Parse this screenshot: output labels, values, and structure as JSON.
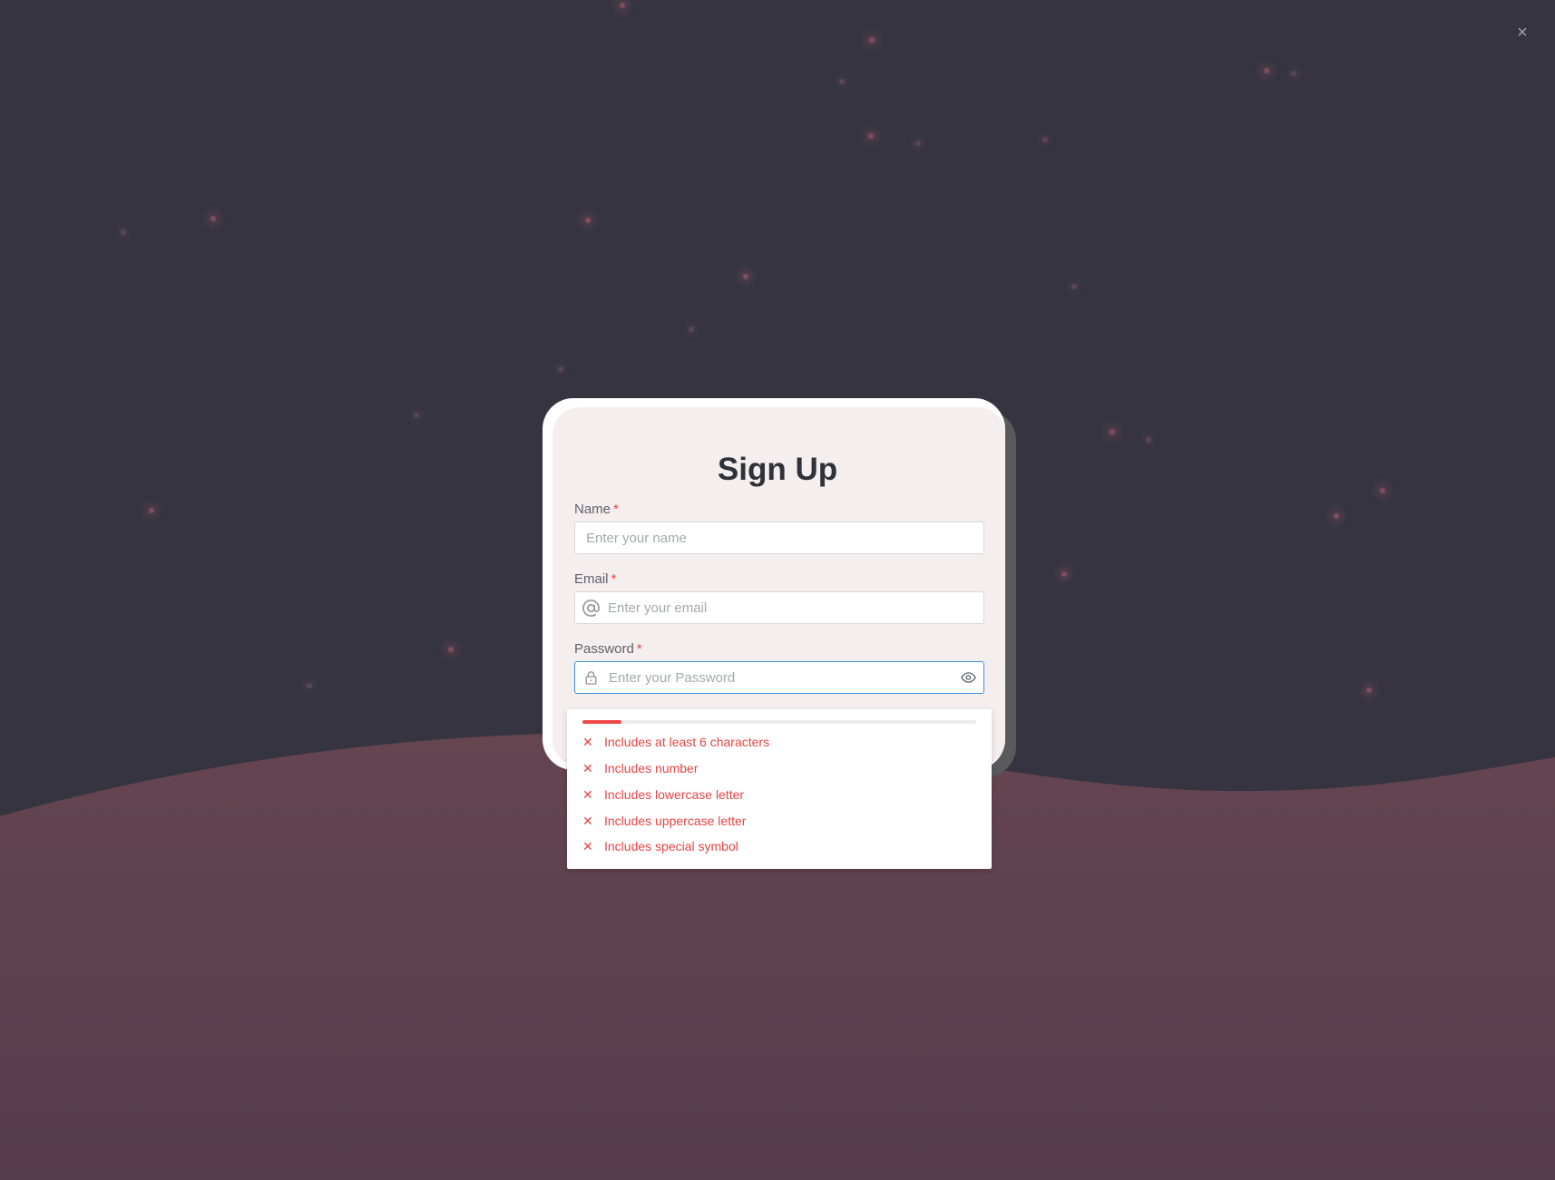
{
  "page": {
    "close_label": "×"
  },
  "form": {
    "title": "Sign Up",
    "name": {
      "label": "Name",
      "required_mark": "*",
      "placeholder": "Enter your name",
      "value": ""
    },
    "email": {
      "label": "Email",
      "required_mark": "*",
      "placeholder": "Enter your email",
      "value": ""
    },
    "password": {
      "label": "Password",
      "required_mark": "*",
      "placeholder": "Enter your Password",
      "value": ""
    }
  },
  "password_strength": {
    "level_fraction": 0.1,
    "fill_color": "#f04848",
    "rules": [
      {
        "icon": "close-icon",
        "text": "Includes at least 6 characters",
        "met": false
      },
      {
        "icon": "close-icon",
        "text": "Includes number",
        "met": false
      },
      {
        "icon": "close-icon",
        "text": "Includes lowercase letter",
        "met": false
      },
      {
        "icon": "close-icon",
        "text": "Includes uppercase letter",
        "met": false
      },
      {
        "icon": "close-icon",
        "text": "Includes special symbol",
        "met": false
      }
    ]
  },
  "colors": {
    "background": "#363441",
    "wave": "#5d4250",
    "card": "#f5eeee",
    "error": "#e64545",
    "focus": "#3d8fd6"
  }
}
